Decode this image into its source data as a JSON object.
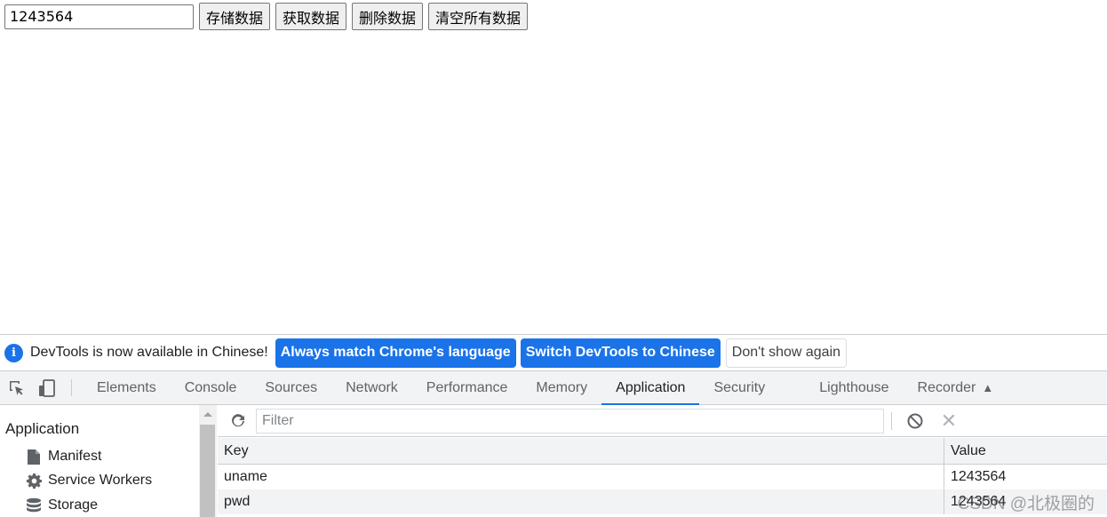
{
  "page": {
    "input_value": "1243564",
    "buttons": [
      "存储数据",
      "获取数据",
      "删除数据",
      "清空所有数据"
    ]
  },
  "infobar": {
    "icon": "info-icon",
    "message": "DevTools is now available in Chinese!",
    "btn_match": "Always match Chrome's language",
    "btn_switch": "Switch DevTools to Chinese",
    "btn_dismiss": "Don't show again"
  },
  "devtools": {
    "tabs": [
      "Elements",
      "Console",
      "Sources",
      "Network",
      "Performance",
      "Memory",
      "Application",
      "Security",
      "Lighthouse",
      "Recorder"
    ],
    "active_tab": "Application",
    "sidebar": {
      "heading": "Application",
      "items": [
        {
          "label": "Manifest",
          "icon": "file-icon"
        },
        {
          "label": "Service Workers",
          "icon": "gear-icon"
        },
        {
          "label": "Storage",
          "icon": "database-icon"
        }
      ]
    },
    "storage": {
      "filter_placeholder": "Filter",
      "columns": {
        "key": "Key",
        "value": "Value"
      },
      "rows": [
        {
          "key": "uname",
          "value": "1243564"
        },
        {
          "key": "pwd",
          "value": "1243564"
        }
      ]
    }
  },
  "watermark": "CSDN @北极圈的",
  "colors": {
    "accent": "#1a73e8",
    "toolbar_bg": "#f1f3f4",
    "border": "#cbcdd1"
  }
}
